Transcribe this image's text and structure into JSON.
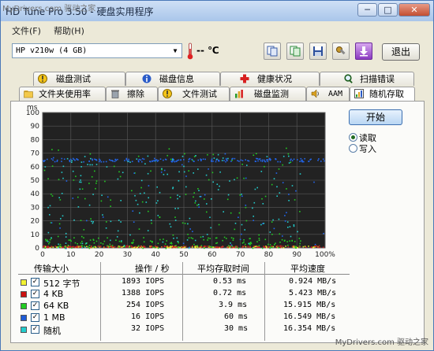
{
  "window": {
    "title": "HD Tune Pro 3.50 - 硬盘实用程序",
    "watermark_top": "MyDrivers.com 驱动之家",
    "buttons": {
      "minimize": "─",
      "maximize": "□",
      "close": "✕"
    }
  },
  "menu": {
    "file": "文件(F)",
    "help": "帮助(H)"
  },
  "toolbar": {
    "drive": "HP        v210w (4 GB)",
    "temperature": "-- ℃",
    "exit_label": "退出",
    "icons": [
      "copy-icon",
      "copy-icon",
      "save-icon",
      "tools-icon",
      "download-icon"
    ]
  },
  "tabs_row1": [
    {
      "label": "磁盘测试",
      "icon": "exclamation-icon"
    },
    {
      "label": "磁盘信息",
      "icon": "info-icon"
    },
    {
      "label": "健康状况",
      "icon": "health-cross-icon"
    },
    {
      "label": "扫描错误",
      "icon": "magnifier-icon"
    }
  ],
  "tabs_row2": [
    {
      "label": "文件夹使用率",
      "icon": "folder-icon"
    },
    {
      "label": "擦除",
      "icon": "trash-icon"
    },
    {
      "label": "文件测试",
      "icon": "exclamation-icon"
    },
    {
      "label": "磁盘监测",
      "icon": "bars-icon"
    },
    {
      "label": "AAM",
      "icon": "speaker-icon"
    },
    {
      "label": "随机存取",
      "icon": "random-access-icon",
      "active": true
    }
  ],
  "controls": {
    "start_label": "开始",
    "mode_read": "读取",
    "mode_write": "写入",
    "selected_mode": "read"
  },
  "chart_data": {
    "type": "scatter",
    "ylabel": "ms",
    "yticks": [
      "100",
      "90",
      "80",
      "70",
      "60",
      "50",
      "40",
      "30",
      "20",
      "10",
      "0"
    ],
    "xticks": [
      "0",
      "10",
      "20",
      "30",
      "40",
      "50",
      "60",
      "70",
      "80",
      "90",
      "100%"
    ],
    "ylim": [
      0,
      100
    ],
    "xlim": [
      0,
      100
    ],
    "background": "#222222",
    "grid": true,
    "series": [
      {
        "color": "#e6e62a",
        "latency_ms": 0.53,
        "band": "low"
      },
      {
        "color": "#cc2222",
        "latency_ms": 0.72,
        "band": "low"
      },
      {
        "color": "#22cc22",
        "latency_ms": 3.9,
        "band": "scatter"
      },
      {
        "color": "#2266ee",
        "latency_ms": 60,
        "band": "line"
      },
      {
        "color": "#22cccc",
        "latency_ms": 30,
        "band": "scatter"
      }
    ]
  },
  "results": {
    "headers": [
      "传输大小",
      "操作 / 秒",
      "平均存取时间",
      "平均速度"
    ],
    "rows": [
      {
        "color": "#f2f230",
        "checked": "✓",
        "size": "512 字节",
        "ops": "1893 IOPS",
        "access": "0.53 ms",
        "speed": "0.924 MB/s"
      },
      {
        "color": "#cc1111",
        "checked": "✓",
        "size": "4 KB",
        "ops": "1388 IOPS",
        "access": "0.72 ms",
        "speed": "5.423 MB/s"
      },
      {
        "color": "#22cc22",
        "checked": "✓",
        "size": "64 KB",
        "ops": " 254 IOPS",
        "access": "3.9 ms",
        "speed": "15.915 MB/s"
      },
      {
        "color": "#1e5bd6",
        "checked": "✓",
        "size": "1 MB",
        "ops": "  16 IOPS",
        "access": "60 ms",
        "speed": "16.549 MB/s"
      },
      {
        "color": "#22cccc",
        "checked": "✓",
        "size": "随机",
        "ops": "  32 IOPS",
        "access": "30 ms",
        "speed": "16.354 MB/s"
      }
    ]
  },
  "footer": {
    "watermark": "MyDrivers.com 驱动之家"
  }
}
